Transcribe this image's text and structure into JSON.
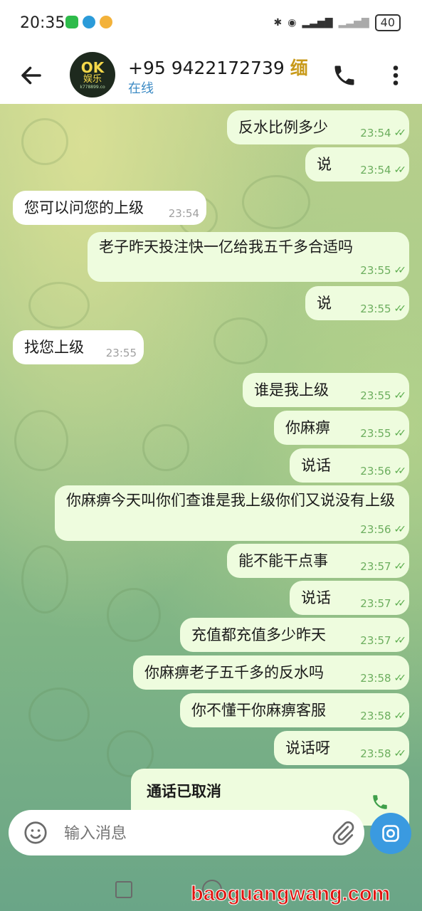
{
  "status_bar": {
    "time": "20:35",
    "battery": "40"
  },
  "header": {
    "avatar": {
      "line1": "OK",
      "line2": "娱乐",
      "site": "k778899.co"
    },
    "contact_name": "+95 9422172739",
    "contact_flag": "缅",
    "status": "在线"
  },
  "messages": [
    {
      "dir": "out",
      "text": "反水比例多少",
      "time": "23:54"
    },
    {
      "dir": "out",
      "text": "说",
      "time": "23:54"
    },
    {
      "dir": "in",
      "text": "您可以问您的上级",
      "time": "23:54"
    },
    {
      "dir": "out",
      "text": "老子昨天投注快一亿给我五千多合适吗",
      "time": "23:55"
    },
    {
      "dir": "out",
      "text": "说",
      "time": "23:55"
    },
    {
      "dir": "in",
      "text": "找您上级",
      "time": "23:55"
    },
    {
      "dir": "out",
      "text": "谁是我上级",
      "time": "23:55"
    },
    {
      "dir": "out",
      "text": "你麻痹",
      "time": "23:55"
    },
    {
      "dir": "out",
      "text": "说话",
      "time": "23:56"
    },
    {
      "dir": "out",
      "text": "你麻痹今天叫你们查谁是我上级你们又说没有上级",
      "time": "23:56"
    },
    {
      "dir": "out",
      "text": "能不能干点事",
      "time": "23:57"
    },
    {
      "dir": "out",
      "text": "说话",
      "time": "23:57"
    },
    {
      "dir": "out",
      "text": "充值都充值多少昨天",
      "time": "23:57"
    },
    {
      "dir": "out",
      "text": "你麻痹老子五千多的反水吗",
      "time": "23:58"
    },
    {
      "dir": "out",
      "text": "你不懂干你麻痹客服",
      "time": "23:58"
    },
    {
      "dir": "out",
      "text": "说话呀",
      "time": "23:58"
    }
  ],
  "call_card": {
    "title": "通话已取消"
  },
  "composer": {
    "placeholder": "输入消息"
  },
  "watermark": "baoguangwang.com",
  "colors": {
    "outgoing_bubble": "#eefcde",
    "incoming_bubble": "#ffffff",
    "accent": "#3a9ae0",
    "check": "#5aac4c"
  }
}
